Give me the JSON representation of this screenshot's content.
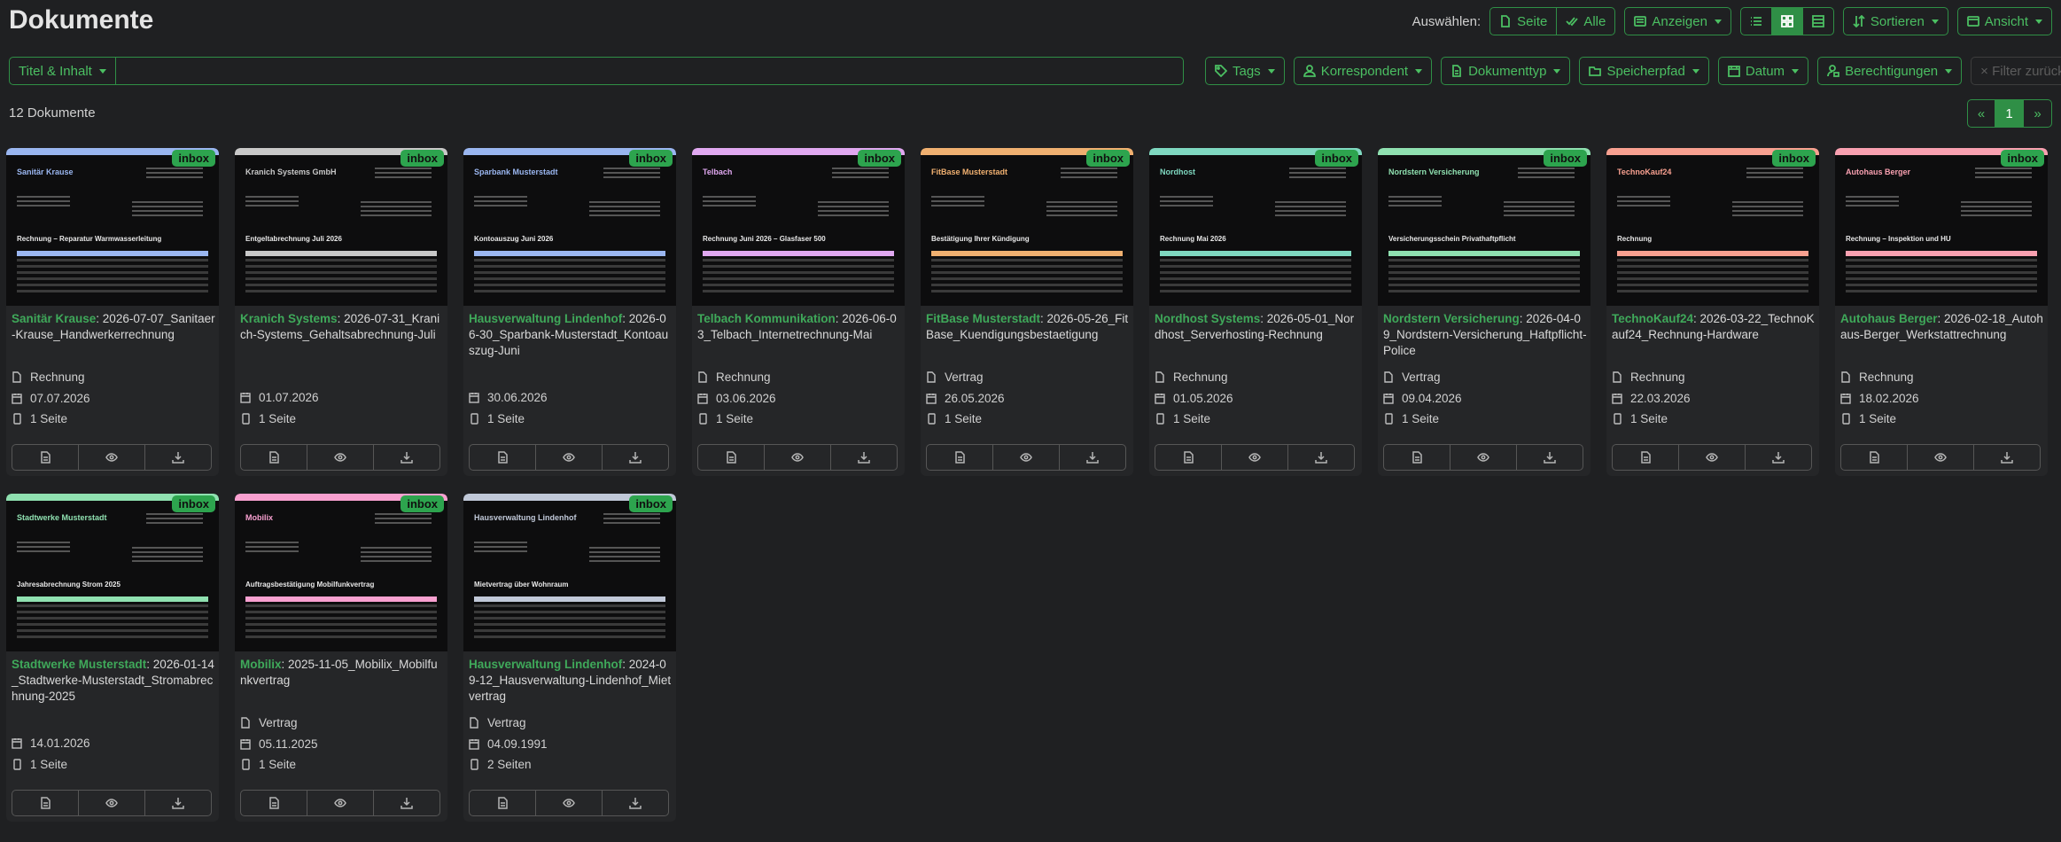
{
  "page": {
    "title": "Dokumente",
    "select_label": "Auswählen:",
    "btn_page": "Seite",
    "btn_all": "Alle",
    "btn_show": "Anzeigen",
    "btn_sort": "Sortieren",
    "btn_view": "Ansicht",
    "title_content": "Titel & Inhalt",
    "search_placeholder": "",
    "f_tags": "Tags",
    "f_correspondent": "Korrespondent",
    "f_doctype": "Dokumenttyp",
    "f_storage": "Speicherpfad",
    "f_date": "Datum",
    "f_perms": "Berechtigungen",
    "reset": "× Filter zurücksetzen",
    "count": "12 Dokumente",
    "pager_prev": "«",
    "pager_page": "1",
    "pager_next": "»",
    "tag_label": "inbox"
  },
  "documents": [
    {
      "correspondent": "Sanitär Krause",
      "title": ": 2026-07-07_Sanitaer-Krause_Handwerkerrechnung",
      "type": "Rechnung",
      "date": "07.07.2026",
      "pages": "1 Seite",
      "color": "#9ab6f0",
      "thumb_logo": "Sanitär Krause",
      "thumb_heading": "Rechnung – Reparatur Warmwasserleitung"
    },
    {
      "correspondent": "Kranich Systems",
      "title": ": 2026-07-31_Kranich-Systems_Gehaltsabrechnung-Juli",
      "type": "",
      "date": "01.07.2026",
      "pages": "1 Seite",
      "color": "#c8c8c8",
      "thumb_logo": "Kranich Systems GmbH",
      "thumb_heading": "Entgeltabrechnung Juli 2026"
    },
    {
      "correspondent": "Hausverwaltung Lindenhof",
      "title": ": 2026-06-30_Sparbank-Musterstadt_Kontoauszug-Juni",
      "type": "",
      "date": "30.06.2026",
      "pages": "1 Seite",
      "color": "#9ab6f0",
      "thumb_logo": "Sparbank Musterstadt",
      "thumb_heading": "Kontoauszug Juni 2026"
    },
    {
      "correspondent": "Telbach Kommunikation",
      "title": ": 2026-06-03_Telbach_Internetrechnung-Mai",
      "type": "Rechnung",
      "date": "03.06.2026",
      "pages": "1 Seite",
      "color": "#e0a8f0",
      "thumb_logo": "Telbach",
      "thumb_heading": "Rechnung Juni 2026 – Glasfaser 500"
    },
    {
      "correspondent": "FitBase Musterstadt",
      "title": ": 2026-05-26_FitBase_Kuendigungsbestaetigung",
      "type": "Vertrag",
      "date": "26.05.2026",
      "pages": "1 Seite",
      "color": "#f0b070",
      "thumb_logo": "FitBase Musterstadt",
      "thumb_heading": "Bestätigung Ihrer Kündigung"
    },
    {
      "correspondent": "Nordhost Systems",
      "title": ": 2026-05-01_Nordhost_Serverhosting-Rechnung",
      "type": "Rechnung",
      "date": "01.05.2026",
      "pages": "1 Seite",
      "color": "#7fd8c0",
      "thumb_logo": "Nordhost",
      "thumb_heading": "Rechnung Mai 2026"
    },
    {
      "correspondent": "Nordstern Versicherung",
      "title": ": 2026-04-09_Nordstern-Versicherung_Haftpflicht-Police",
      "type": "Vertrag",
      "date": "09.04.2026",
      "pages": "1 Seite",
      "color": "#8fe0b0",
      "thumb_logo": "Nordstern Versicherung",
      "thumb_heading": "Versicherungsschein Privathaftpflicht"
    },
    {
      "correspondent": "TechnoKauf24",
      "title": ": 2026-03-22_TechnoKauf24_Rechnung-Hardware",
      "type": "Rechnung",
      "date": "22.03.2026",
      "pages": "1 Seite",
      "color": "#f8a090",
      "thumb_logo": "TechnoKauf24",
      "thumb_heading": "Rechnung"
    },
    {
      "correspondent": "Autohaus Berger",
      "title": ": 2026-02-18_Autohaus-Berger_Werkstattrechnung",
      "type": "Rechnung",
      "date": "18.02.2026",
      "pages": "1 Seite",
      "color": "#f8a0b0",
      "thumb_logo": "Autohaus Berger",
      "thumb_heading": "Rechnung – Inspektion und HU"
    },
    {
      "correspondent": "Stadtwerke Musterstadt",
      "title": ": 2026-01-14_Stadtwerke-Musterstadt_Stromabrechnung-2025",
      "type": "",
      "date": "14.01.2026",
      "pages": "1 Seite",
      "color": "#8fe0b0",
      "thumb_logo": "Stadtwerke Musterstadt",
      "thumb_heading": "Jahresabrechnung Strom 2025"
    },
    {
      "correspondent": "Mobilix",
      "title": ": 2025-11-05_Mobilix_Mobilfunkvertrag",
      "type": "Vertrag",
      "date": "05.11.2025",
      "pages": "1 Seite",
      "color": "#f8a0d0",
      "thumb_logo": "Mobilix",
      "thumb_heading": "Auftragsbestätigung Mobilfunkvertrag"
    },
    {
      "correspondent": "Hausverwaltung Lindenhof",
      "title": ": 2024-09-12_Hausverwaltung-Lindenhof_Mietvertrag",
      "type": "Vertrag",
      "date": "04.09.1991",
      "pages": "2 Seiten",
      "color": "#c0c8d8",
      "thumb_logo": "Hausverwaltung Lindenhof",
      "thumb_heading": "Mietvertrag über Wohnraum"
    }
  ]
}
